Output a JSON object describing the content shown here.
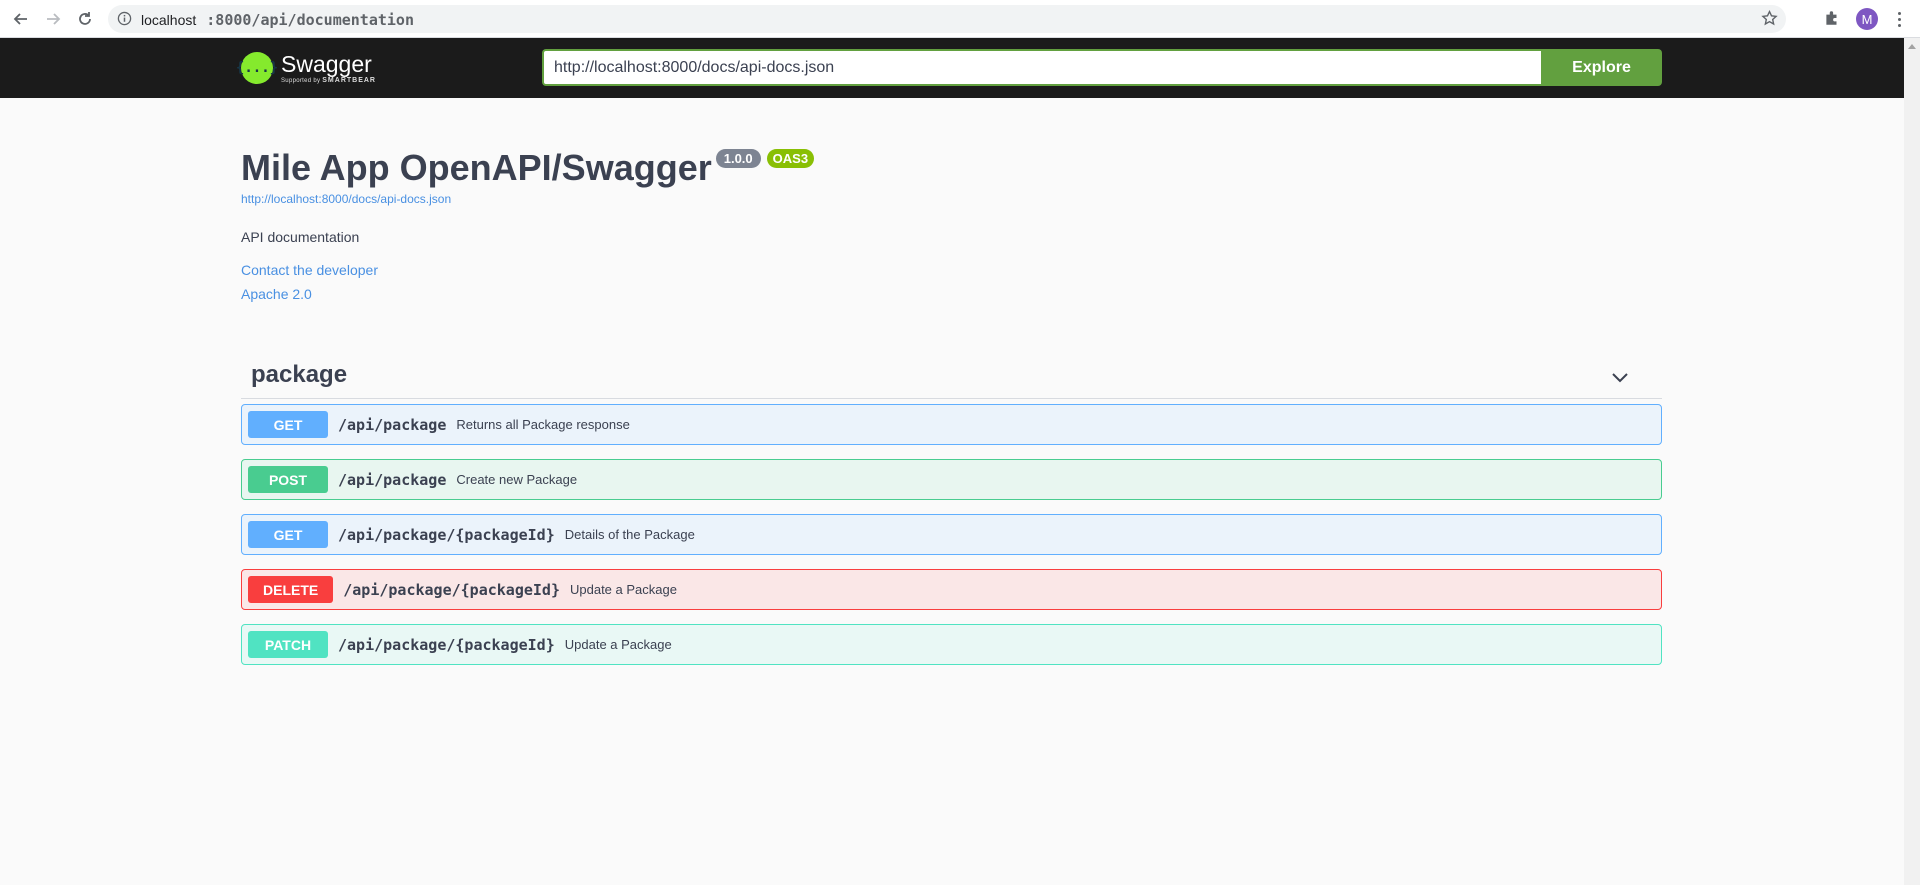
{
  "browser": {
    "address_host": "localhost",
    "address_path": ":8000/api/documentation",
    "avatar_letter": "M"
  },
  "topbar": {
    "logo_icon_text": "{...}",
    "logo_name": "Swagger",
    "logo_sub_prefix": "Supported by",
    "logo_sub_brand": "SMARTBEAR",
    "url_value": "http://localhost:8000/docs/api-docs.json",
    "explore_label": "Explore"
  },
  "info": {
    "title": "Mile App OpenAPI/Swagger",
    "version": "1.0.0",
    "oas": "OAS3",
    "spec_url": "http://localhost:8000/docs/api-docs.json",
    "description": "API documentation",
    "contact": "Contact the developer",
    "license": "Apache 2.0"
  },
  "tag": {
    "name": "package",
    "expanded": true
  },
  "operations": [
    {
      "method": "GET",
      "path": "/api/package",
      "summary": "Returns all Package response"
    },
    {
      "method": "POST",
      "path": "/api/package",
      "summary": "Create new Package"
    },
    {
      "method": "GET",
      "path": "/api/package/{packageId}",
      "summary": "Details of the Package"
    },
    {
      "method": "DELETE",
      "path": "/api/package/{packageId}",
      "summary": "Update a Package"
    },
    {
      "method": "PATCH",
      "path": "/api/package/{packageId}",
      "summary": "Update a Package"
    }
  ],
  "colors": {
    "get": "#61affe",
    "post": "#49cc90",
    "delete": "#f93e3e",
    "patch": "#50e3c2",
    "explore": "#62a03f",
    "oas_badge": "#89bf04"
  }
}
